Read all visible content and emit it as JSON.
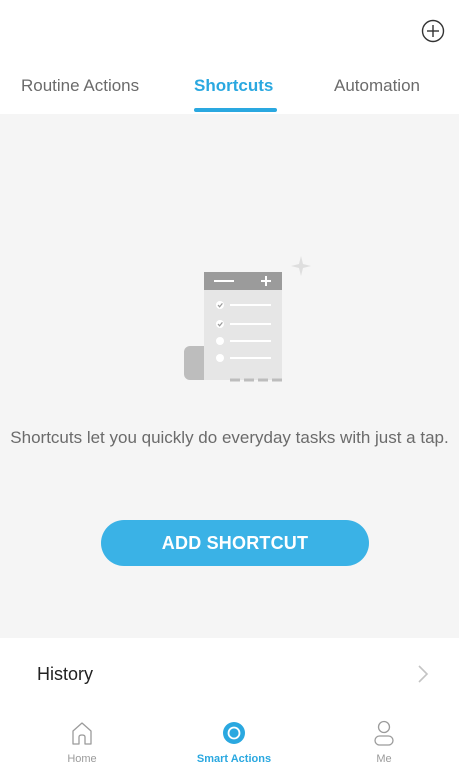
{
  "header": {
    "add_icon": "plus-circle-icon"
  },
  "tabs": [
    {
      "label": "Routine Actions",
      "active": false
    },
    {
      "label": "Shortcuts",
      "active": true
    },
    {
      "label": "Automation",
      "active": false
    }
  ],
  "empty_state": {
    "illustration_icon": "checklist-document-icon",
    "message": "Shortcuts let you quickly do everyday tasks with just a tap.",
    "button_label": "ADD SHORTCUT"
  },
  "history": {
    "label": "History",
    "chevron_icon": "chevron-right-icon"
  },
  "bottom_nav": [
    {
      "label": "Home",
      "icon": "home-icon",
      "active": false
    },
    {
      "label": "Smart Actions",
      "icon": "smart-actions-icon",
      "active": true
    },
    {
      "label": "Me",
      "icon": "person-icon",
      "active": false
    }
  ],
  "colors": {
    "accent": "#2aa8e0",
    "button": "#3ab2e6",
    "background": "#f5f5f5"
  }
}
